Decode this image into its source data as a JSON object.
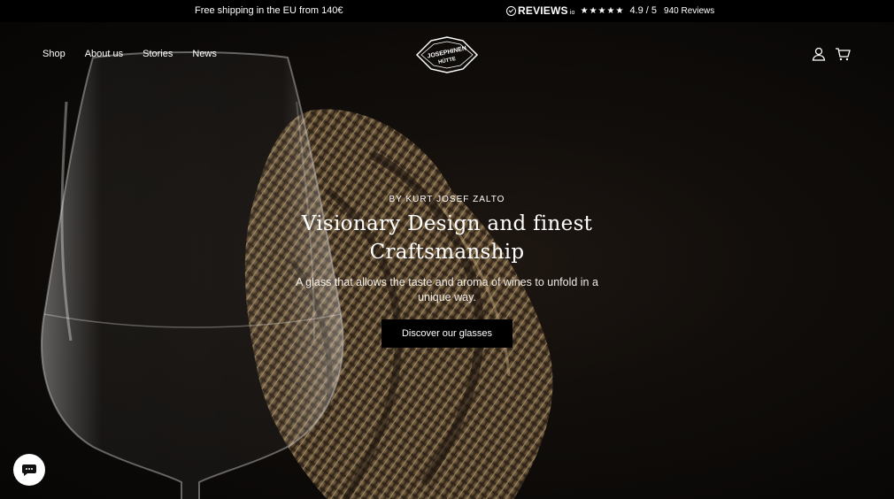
{
  "announcement": {
    "shipping": "Free shipping in the EU from 140€",
    "reviews_brand": "REVIEWS",
    "reviews_suffix": "io",
    "stars": "★★★★★",
    "rating": "4.9 / 5",
    "count_number": "940",
    "count_label": "Reviews"
  },
  "nav": {
    "items": [
      "Shop",
      "About us",
      "Stories",
      "News"
    ]
  },
  "logo": {
    "line1": "JOSEPHINEN",
    "line2": "HÜTTE"
  },
  "hero": {
    "eyebrow": "BY KURT JOSEF ZALTO",
    "headline_line1": "Visionary Design and finest",
    "headline_line2": "Craftsmanship",
    "subtext": "A glass that allows the taste and aroma of wines to unfold in a unique way.",
    "cta": "Discover our glasses"
  },
  "icons": {
    "account": "user-icon",
    "cart": "cart-icon",
    "chat": "chat-icon"
  },
  "colors": {
    "background": "#0b0908",
    "sculpture": "#8a7150",
    "button": "#000000"
  }
}
